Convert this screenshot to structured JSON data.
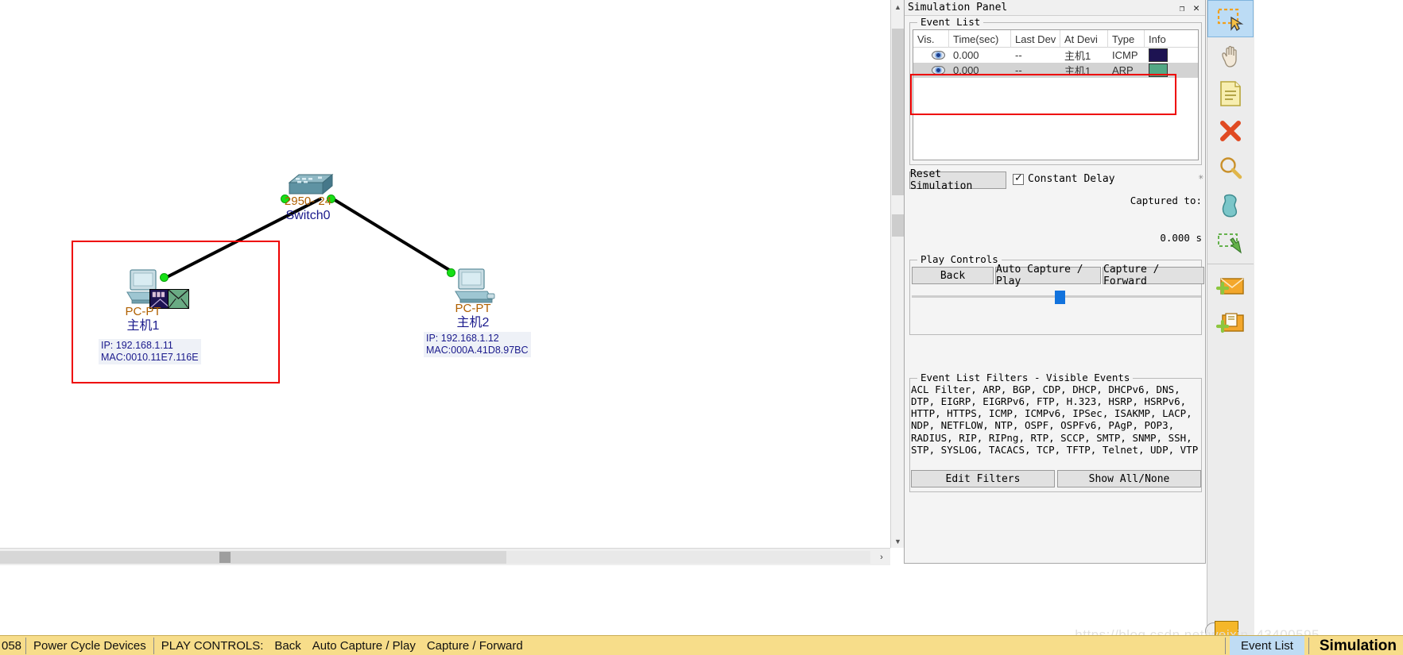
{
  "sim_panel": {
    "title": "Simulation Panel",
    "restore_icon": "restore-icon",
    "close_icon": "close-icon",
    "event_list": {
      "legend": "Event List",
      "columns": [
        "Vis.",
        "Time(sec)",
        "Last Dev",
        "At Devi",
        "Type",
        "Info"
      ],
      "rows": [
        {
          "vis": "eye-icon",
          "time": "0.000",
          "last_dev": "--",
          "at_device": "主机1",
          "type": "ICMP",
          "info_color": "#1d1352",
          "selected": false
        },
        {
          "vis": "eye-icon",
          "time": "0.000",
          "last_dev": "--",
          "at_device": "主机1",
          "type": "ARP",
          "info_color": "#53a885",
          "selected": true
        }
      ]
    },
    "reset_button": "Reset Simulation",
    "constant_delay_label": "Constant Delay",
    "constant_delay_checked": true,
    "captured_label": "Captured to:",
    "captured_value": "0.000 s",
    "play_controls": {
      "legend": "Play Controls",
      "back": "Back",
      "auto_capture_play": "Auto Capture / Play",
      "capture_forward": "Capture / Forward",
      "slider_handle_color": "#1273dd"
    },
    "filters": {
      "legend": "Event List Filters - Visible Events",
      "text": "ACL Filter, ARP, BGP, CDP, DHCP, DHCPv6, DNS, DTP, EIGRP, EIGRPv6, FTP, H.323, HSRP, HSRPv6, HTTP, HTTPS, ICMP, ICMPv6, IPSec, ISAKMP, LACP, NDP, NETFLOW, NTP, OSPF, OSPFv6, PAgP, POP3, RADIUS, RIP, RIPng, RTP, SCCP, SMTP, SNMP, SSH, STP, SYSLOG, TACACS, TCP, TFTP, Telnet, UDP, VTP",
      "edit_filters": "Edit Filters",
      "show_all_none": "Show All/None"
    }
  },
  "topology": {
    "switch": {
      "model": "2950- 24",
      "name": "Switch0"
    },
    "pc1": {
      "model": "PC-PT",
      "name": "主机1",
      "ip": "IP: 192.168.1.11",
      "mac": "MAC:0010.11E7.116E",
      "packet_icmp_color": "#1d1352",
      "packet_arp_color": "#6aab84"
    },
    "pc2": {
      "model": "PC-PT",
      "name": "主机2",
      "ip": "IP: 192.168.1.12",
      "mac": "MAC:000A.41D8.97BC"
    },
    "highlight_color": "#ee0000"
  },
  "tool_dock": {
    "tools": [
      {
        "name": "select-icon",
        "active": true
      },
      {
        "name": "hand-move-icon",
        "active": false
      },
      {
        "name": "note-icon",
        "active": false
      },
      {
        "name": "delete-icon",
        "active": false
      },
      {
        "name": "inspect-magnifier-icon",
        "active": false
      },
      {
        "name": "draw-shape-icon",
        "active": false
      },
      {
        "name": "resize-shape-icon",
        "active": false
      },
      {
        "name": "add-simple-pdu-icon",
        "active": false
      },
      {
        "name": "add-complex-pdu-icon",
        "active": false
      }
    ]
  },
  "status_bar": {
    "number": "058",
    "power_cycle": "Power Cycle Devices",
    "play_controls_label": "PLAY CONTROLS:",
    "back": "Back",
    "auto_capture_play": "Auto Capture / Play",
    "capture_forward": "Capture / Forward",
    "event_list_tab": "Event List",
    "mode": "Simulation",
    "watermark": "https://blog.csdn.net/weixin_43400595"
  },
  "scrollbars": {
    "up_arrow": "▲",
    "down_arrow": "▼",
    "right_arrow": "›"
  }
}
